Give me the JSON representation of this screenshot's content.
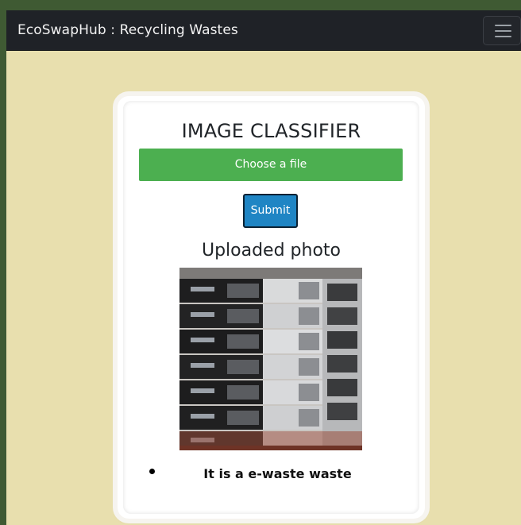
{
  "navbar": {
    "brand": "EcoSwapHub : Recycling Wastes",
    "menu_icon": "hamburger-menu-icon"
  },
  "classifier": {
    "title": "IMAGE CLASSIFIER",
    "choose_file_label": "Choose a file",
    "submit_label": "Submit",
    "uploaded_heading": "Uploaded photo",
    "result": "It is a e-waste waste"
  },
  "colors": {
    "navbar_bg": "#1f2227",
    "page_bg": "#e8dfae",
    "choose_file_bg": "#4caf50",
    "submit_bg": "#1f85c4"
  }
}
